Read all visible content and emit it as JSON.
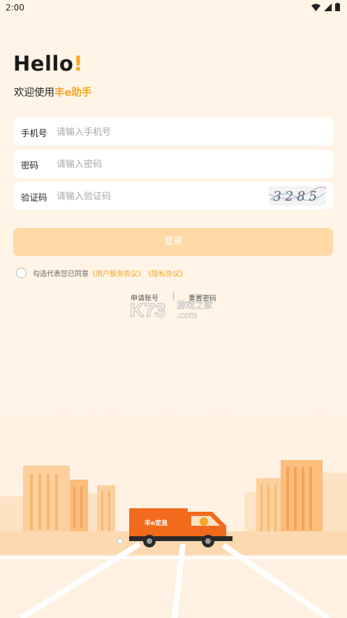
{
  "status_bar": {
    "time": "2:00"
  },
  "header": {
    "hello": "Hello",
    "bang": "!",
    "welcome_prefix": "欢迎使用",
    "brand": "丰e助手"
  },
  "form": {
    "phone": {
      "label": "手机号",
      "placeholder": "请输入手机号",
      "value": ""
    },
    "password": {
      "label": "密码",
      "placeholder": "请输入密码",
      "value": ""
    },
    "captcha": {
      "label": "验证码",
      "placeholder": "请输入验证码",
      "value": "",
      "image_text": "3285"
    }
  },
  "login_button": "登录",
  "agreement": {
    "prefix": "勾选代表您已同意",
    "terms": "《用户服务协议》",
    "privacy": "《隐私协议》"
  },
  "links": {
    "apply": "申请账号",
    "separator": "|",
    "reset": "重置密码"
  },
  "watermark": {
    "text_big": "K73",
    "text_cn": "游戏之家",
    "domain": ".com"
  },
  "truck": {
    "label": "丰e定良"
  },
  "colors": {
    "accent": "#f5a623",
    "background": "#fff4e6",
    "button_disabled": "#ffd9a6",
    "truck": "#f26b1d"
  }
}
